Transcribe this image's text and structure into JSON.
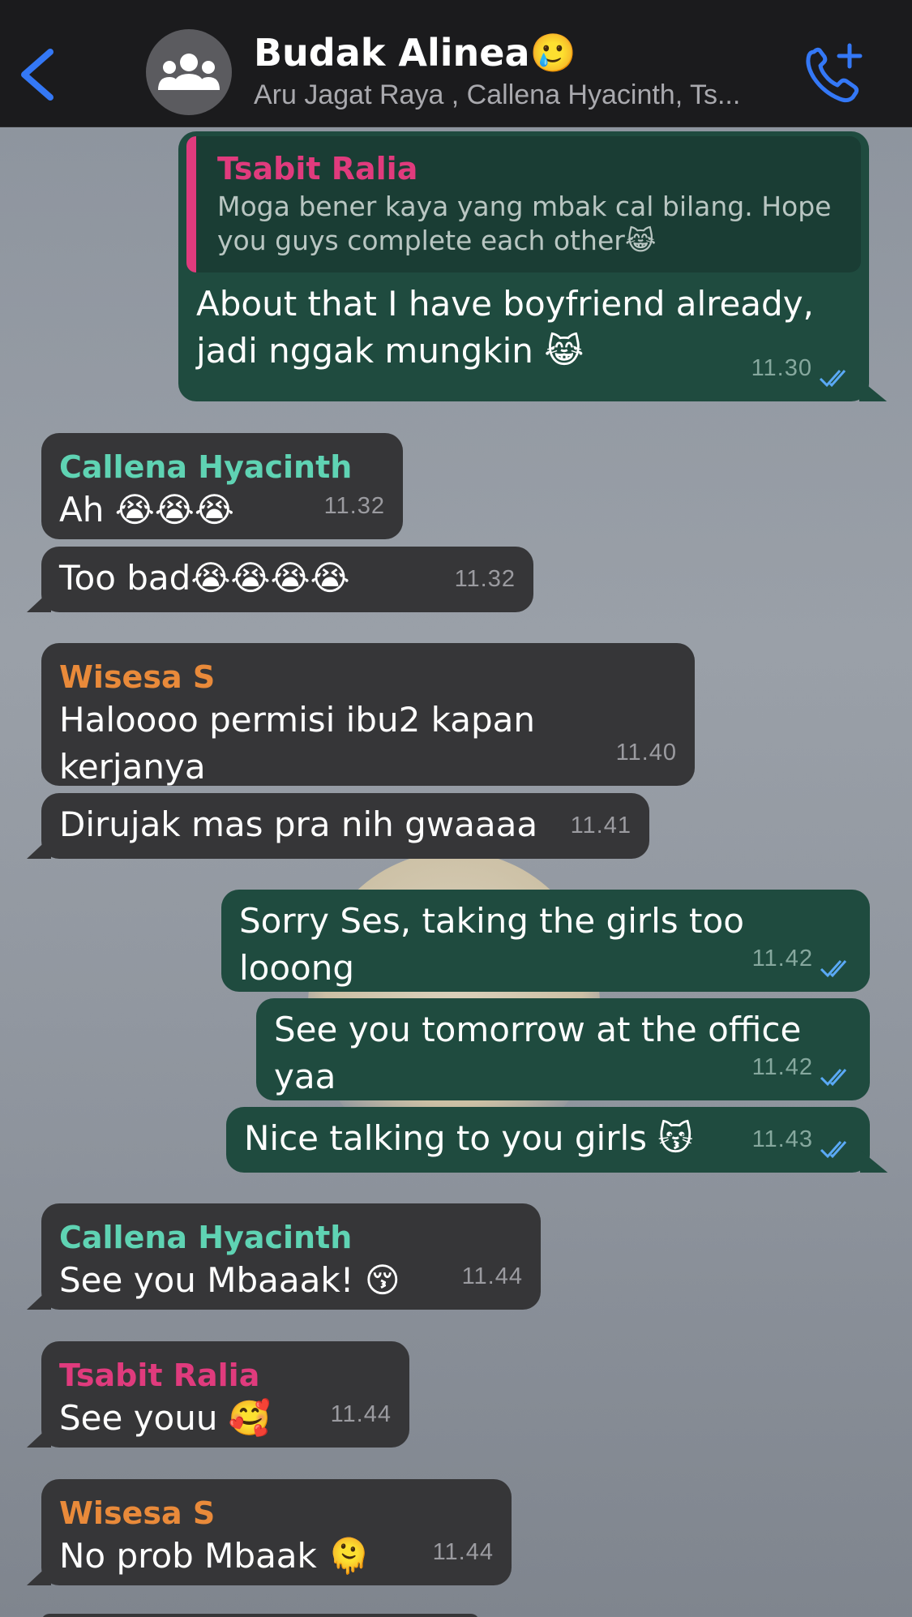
{
  "header": {
    "title": "Budak Alinea🥲",
    "subtitle": "Aru Jagat Raya , Callena Hyacinth, Ts..."
  },
  "colors": {
    "accent_blue": "#3478f6",
    "outgoing_bubble": "#1f4b3f",
    "incoming_bubble": "#363638",
    "name_pink": "#e03b7d",
    "name_teal": "#5fd3b3",
    "name_orange": "#e98a3a"
  },
  "messages": [
    {
      "direction": "out",
      "quote_sender": "Tsabit Ralia",
      "quote_text": "Moga bener kaya yang mbak cal bilang. Hope you guys complete each other😹",
      "text": "About that I have boyfriend already, jadi nggak mungkin 😹",
      "time": "11.30"
    },
    {
      "direction": "in",
      "sender": "Callena Hyacinth",
      "text": "Ah 😭😭😭",
      "time": "11.32"
    },
    {
      "direction": "in",
      "text": "Too bad😭😭😭😭",
      "time": "11.32"
    },
    {
      "direction": "in",
      "sender": "Wisesa S",
      "text": "Haloooo permisi ibu2 kapan kerjanya",
      "time": "11.40"
    },
    {
      "direction": "in",
      "text": "Dirujak mas pra nih gwaaaa",
      "time": "11.41"
    },
    {
      "direction": "out",
      "text": "Sorry Ses, taking the girls too looong",
      "time": "11.42"
    },
    {
      "direction": "out",
      "text": "See you tomorrow at the office yaa",
      "time": "11.42"
    },
    {
      "direction": "out",
      "text": "Nice talking to you girls 😽",
      "time": "11.43"
    },
    {
      "direction": "in",
      "sender": "Callena Hyacinth",
      "text": "See you Mbaaak! 😚",
      "time": "11.44"
    },
    {
      "direction": "in",
      "sender": "Tsabit Ralia",
      "text": "See youu 🥰",
      "time": "11.44"
    },
    {
      "direction": "in",
      "sender": "Wisesa S",
      "text": "No prob Mbaak 🫠",
      "time": "11.44"
    }
  ]
}
